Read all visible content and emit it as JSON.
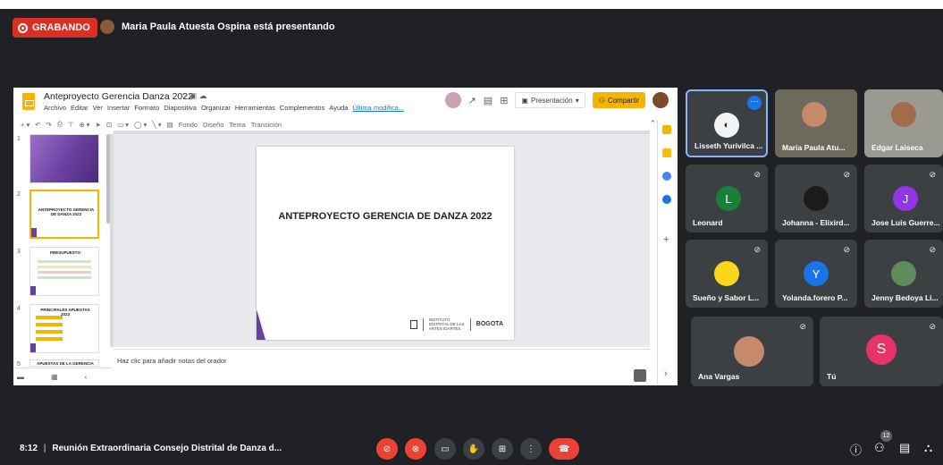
{
  "recording": {
    "label": "GRABANDO"
  },
  "presenting": {
    "text": "Maria Paula Atuesta Ospina está presentando"
  },
  "slides_app": {
    "doc_title": "Anteproyecto Gerencia Danza 2022",
    "menu": [
      "Archivo",
      "Editar",
      "Ver",
      "Insertar",
      "Formato",
      "Diapositiva",
      "Organizar",
      "Herramientas",
      "Complementos",
      "Ayuda"
    ],
    "last_edit": "Última modifica...",
    "present_label": "Presentación",
    "share_label": "Compartir",
    "toolbar": {
      "background": "Fondo",
      "layout": "Diseño",
      "theme": "Tema",
      "transition": "Transición"
    },
    "thumbs": [
      {
        "num": "1"
      },
      {
        "num": "2",
        "text": "ANTEPROYECTO GERENCIA DE DANZA 2022"
      },
      {
        "num": "3",
        "text": "PRESUPUESTO"
      },
      {
        "num": "4",
        "text": "PRINCIPALES APUESTAS 2022"
      },
      {
        "num": "5",
        "text": "APUESTAS DE LA GERENCIA"
      }
    ],
    "slide": {
      "title": "ANTEPROYECTO GERENCIA DE DANZA 2022",
      "logo_text": "INSTITUTO DISTRITAL DE LAS ARTES IDARTES",
      "bogota": "BOGOTA"
    },
    "notes_placeholder": "Haz clic para añadir notas del orador"
  },
  "participants": [
    {
      "name": "Lisseth Yurivilca ...",
      "kind": "photo"
    },
    {
      "name": "Maria Paula Atu...",
      "kind": "video"
    },
    {
      "name": "Edgar Laiseca",
      "kind": "video"
    },
    {
      "name": "Leonard",
      "initial": "L",
      "color": "#188038"
    },
    {
      "name": "Johanna - Elixird...",
      "kind": "photo"
    },
    {
      "name": "Jose Luis Guerre...",
      "initial": "J",
      "color": "#9334e6"
    },
    {
      "name": "Sueño y Sabor L...",
      "kind": "photo"
    },
    {
      "name": "Yolanda.forero P...",
      "initial": "Y",
      "color": "#1a73e8"
    },
    {
      "name": "Jenny Bedoya Li...",
      "kind": "photo"
    },
    {
      "name": "Ana Vargas",
      "kind": "photo"
    },
    {
      "name": "Tú",
      "initial": "S",
      "color": "#e8336a"
    }
  ],
  "meeting": {
    "time": "8:12",
    "title": "Reunión Extraordinaria Consejo Distrital de Danza d...",
    "people_count": "12"
  },
  "colors": {
    "accent": "#f4b400",
    "danger": "#ea4335",
    "brand_purple": "#6a3fa0"
  }
}
